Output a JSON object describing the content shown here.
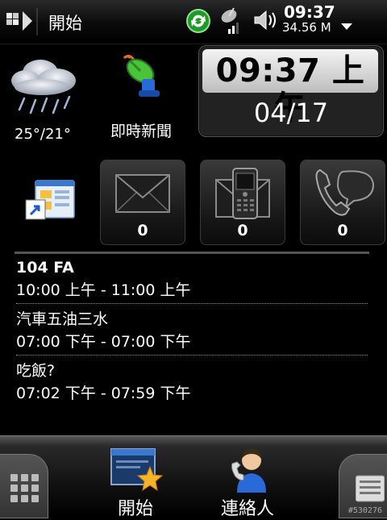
{
  "status_bar": {
    "title": "開始",
    "time": "09:37",
    "storage": "34.56 M",
    "icons": [
      "windows-flag-icon",
      "sync-icon",
      "signal-icon",
      "volume-icon",
      "dropdown-arrow-icon"
    ]
  },
  "weather": {
    "icon": "cloud-rain-icon",
    "temperature": "25°/21°"
  },
  "news": {
    "icon": "satellite-dish-icon",
    "label": "即時新聞"
  },
  "clock": {
    "time": "09:37 上午",
    "date": "04/17"
  },
  "tiles": [
    {
      "icon": "shortcut-icon"
    },
    {
      "icon": "email-icon",
      "count": "0"
    },
    {
      "icon": "sms-phone-icon",
      "count": "0"
    },
    {
      "icon": "missed-call-icon",
      "count": "0"
    }
  ],
  "appointments": [
    {
      "title": "104 FA",
      "time": "10:00 上午 - 11:00 上午"
    },
    {
      "title": "汽車五油三水",
      "time": "07:00 下午 - 07:00 下午"
    },
    {
      "title": "吃飯?",
      "time": "07:02 下午 - 07:59 下午"
    }
  ],
  "bottom_bar": {
    "left_softkey": "開始",
    "right_softkey": "連絡人",
    "watermark": "#530276"
  },
  "colors": {
    "background": "#000000",
    "accent_green": "#2db52d",
    "envelope_gray": "#8a8a8a"
  }
}
